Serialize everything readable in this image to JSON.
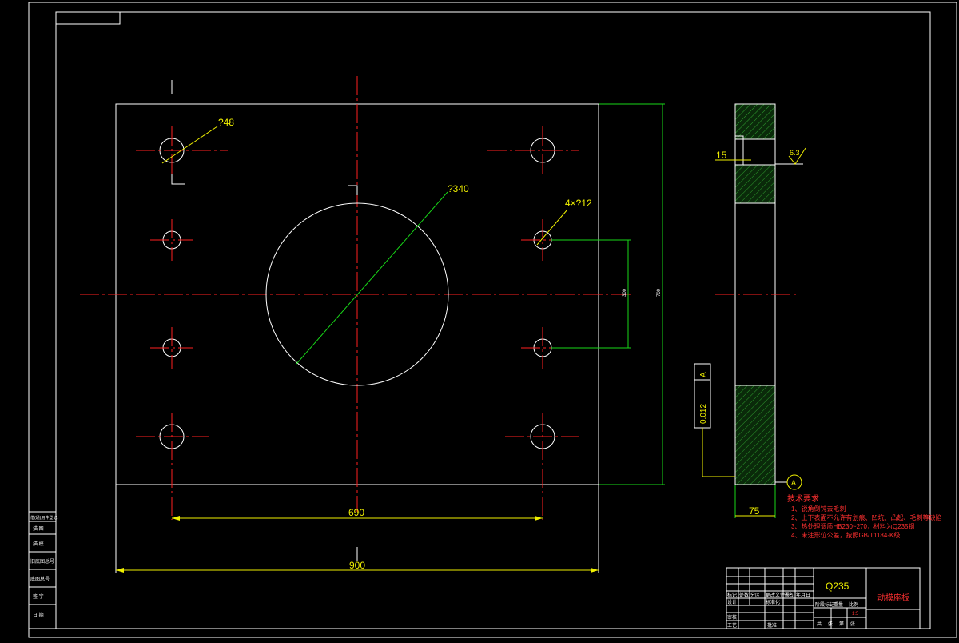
{
  "colors": {
    "background": "#000000",
    "outline": "#ffffff",
    "centerline": "#ff2020",
    "dimension_ext": "#18d818",
    "dimension_text": "#f0f000",
    "hatch": "#1f8f1f",
    "notes": "#ff3030"
  },
  "icons": {
    "roughness": "roughness-symbol-icon",
    "datum": "datum-a-icon"
  },
  "dimensions": {
    "hole_large": "?48",
    "center_bore": "?340",
    "hole_small": "4×?12",
    "hole_spacing": "690",
    "plate_width": "900",
    "side_thickness": "75",
    "counterbore_depth": "15",
    "roughness": "6.3",
    "parallelism_value": "0.012",
    "parallelism_datum": "A",
    "datum_label": "A",
    "small_vert_dim": "300",
    "large_vert_dim": "700"
  },
  "notes": {
    "title": "技术要求",
    "items": [
      "1、锐角倒钝去毛刺",
      "2、上下表面不允许有划痕、凹坑、凸起、毛刺等缺陷",
      "3、热处理调质HB230~270，材料为Q235钢",
      "4、未注形位公差，按照GB/T1184-K级"
    ]
  },
  "title_block": {
    "material": "Q235",
    "part_name": "动模座板",
    "scale": "1:5",
    "headers": [
      "标记",
      "处数",
      "分区",
      "更改文件号",
      "签名",
      "年月日"
    ],
    "roles": [
      "设计",
      "审核",
      "工艺",
      "标准化",
      "批准"
    ],
    "lower_headers": [
      "阶段标记",
      "重量",
      "比例"
    ],
    "sheet_row": [
      "共",
      "张",
      "第",
      "张"
    ]
  },
  "side_stamp": {
    "rows": [
      "借(通)用件登记",
      "描 图",
      "描 校",
      "旧底图总号",
      "底图总号",
      "签 字",
      "日 期"
    ]
  }
}
